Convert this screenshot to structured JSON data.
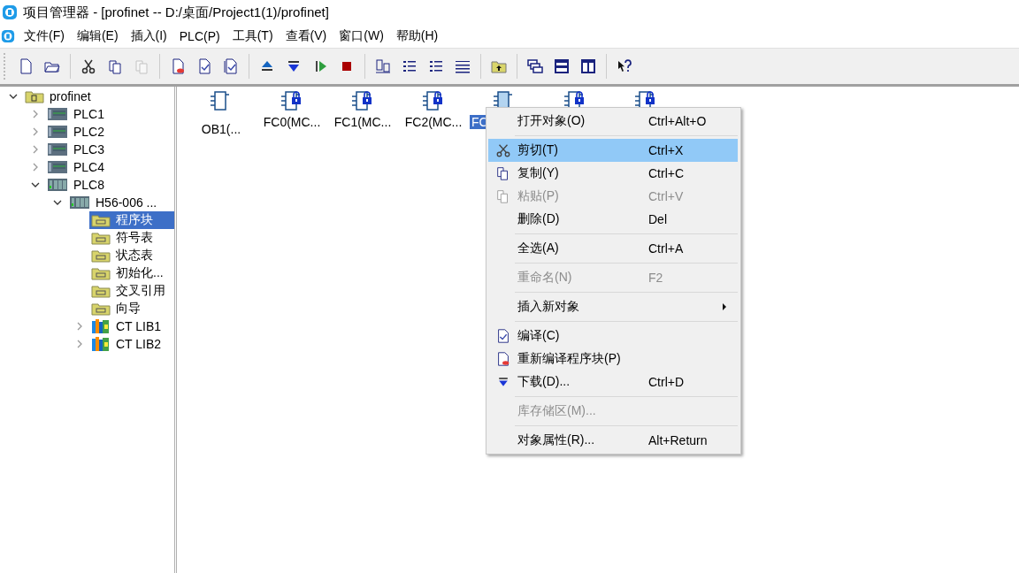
{
  "window": {
    "title": "项目管理器 - [profinet -- D:/桌面/Project1(1)/profinet]"
  },
  "menu_bar": [
    "文件(F)",
    "编辑(E)",
    "插入(I)",
    "PLC(P)",
    "工具(T)",
    "查看(V)",
    "窗口(W)",
    "帮助(H)"
  ],
  "toolbar": [
    {
      "kind": "new",
      "disabled": false
    },
    {
      "kind": "open",
      "disabled": false
    },
    {
      "kind": "sep"
    },
    {
      "kind": "cut",
      "disabled": false
    },
    {
      "kind": "copy",
      "disabled": false
    },
    {
      "kind": "paste",
      "disabled": true
    },
    {
      "kind": "sep"
    },
    {
      "kind": "rebuild",
      "disabled": false
    },
    {
      "kind": "compile",
      "disabled": false
    },
    {
      "kind": "compile-all",
      "disabled": false
    },
    {
      "kind": "sep"
    },
    {
      "kind": "upload",
      "disabled": false
    },
    {
      "kind": "download",
      "disabled": false
    },
    {
      "kind": "run",
      "disabled": false
    },
    {
      "kind": "stop",
      "disabled": false
    },
    {
      "kind": "sep"
    },
    {
      "kind": "devices",
      "disabled": false
    },
    {
      "kind": "list",
      "disabled": false
    },
    {
      "kind": "details",
      "disabled": false
    },
    {
      "kind": "grid",
      "disabled": false
    },
    {
      "kind": "sep"
    },
    {
      "kind": "up-folder",
      "disabled": false
    },
    {
      "kind": "sep"
    },
    {
      "kind": "cascade",
      "disabled": false
    },
    {
      "kind": "tile-h",
      "disabled": false
    },
    {
      "kind": "tile-v",
      "disabled": false
    },
    {
      "kind": "sep"
    },
    {
      "kind": "help",
      "disabled": false
    }
  ],
  "tree": [
    {
      "label": "profinet",
      "kind": "project",
      "expanded": true,
      "selected": false,
      "children": [
        {
          "label": "PLC1",
          "kind": "plc",
          "expanded": false,
          "selected": false
        },
        {
          "label": "PLC2",
          "kind": "plc",
          "expanded": false,
          "selected": false
        },
        {
          "label": "PLC3",
          "kind": "plc",
          "expanded": false,
          "selected": false
        },
        {
          "label": "PLC4",
          "kind": "plc",
          "expanded": false,
          "selected": false
        },
        {
          "label": "PLC8",
          "kind": "rack",
          "expanded": true,
          "selected": false,
          "children": [
            {
              "label": "H56-006 ...",
              "kind": "rack",
              "expanded": true,
              "selected": false,
              "children": [
                {
                  "label": "程序块",
                  "kind": "folder",
                  "selected": true
                },
                {
                  "label": "符号表",
                  "kind": "folder",
                  "selected": false
                },
                {
                  "label": "状态表",
                  "kind": "folder",
                  "selected": false
                },
                {
                  "label": "初始化...",
                  "kind": "folder",
                  "selected": false
                },
                {
                  "label": "交叉引用",
                  "kind": "folder",
                  "selected": false
                },
                {
                  "label": "向导",
                  "kind": "folder",
                  "selected": false
                },
                {
                  "label": "CT LIB1",
                  "kind": "library",
                  "expanded": false,
                  "selected": false
                },
                {
                  "label": "CT LIB2",
                  "kind": "library",
                  "expanded": false,
                  "selected": false
                }
              ]
            }
          ]
        }
      ]
    }
  ],
  "objects": [
    {
      "label": "OB1(...",
      "locked": false,
      "selected": false
    },
    {
      "label": "FC0(MC...",
      "locked": true,
      "selected": false
    },
    {
      "label": "FC1(MC...",
      "locked": true,
      "selected": false
    },
    {
      "label": "FC2(MC...",
      "locked": true,
      "selected": false
    },
    {
      "label": "FC",
      "locked": false,
      "selected": true
    },
    {
      "locked": true,
      "selected": false
    },
    {
      "locked": true,
      "selected": false
    }
  ],
  "context_menu": [
    {
      "kind": "item",
      "label": "打开对象(O)",
      "shortcut": "Ctrl+Alt+O",
      "disabled": false,
      "selected": false
    },
    {
      "kind": "separator"
    },
    {
      "kind": "cut",
      "label": "剪切(T)",
      "shortcut": "Ctrl+X",
      "disabled": false,
      "selected": true
    },
    {
      "kind": "copy",
      "label": "复制(Y)",
      "shortcut": "Ctrl+C",
      "disabled": false,
      "selected": false
    },
    {
      "kind": "paste",
      "label": "粘贴(P)",
      "shortcut": "Ctrl+V",
      "disabled": true,
      "selected": false
    },
    {
      "kind": "item",
      "label": "删除(D)",
      "shortcut": "Del",
      "disabled": false,
      "selected": false
    },
    {
      "kind": "separator"
    },
    {
      "kind": "item",
      "label": "全选(A)",
      "shortcut": "Ctrl+A",
      "disabled": false,
      "selected": false
    },
    {
      "kind": "separator"
    },
    {
      "kind": "item",
      "label": "重命名(N)",
      "shortcut": "F2",
      "disabled": true,
      "selected": false
    },
    {
      "kind": "separator"
    },
    {
      "kind": "submenu",
      "label": "插入新对象",
      "disabled": false,
      "selected": false
    },
    {
      "kind": "separator"
    },
    {
      "kind": "compile",
      "label": "编译(C)",
      "disabled": false,
      "selected": false
    },
    {
      "kind": "rebuild",
      "label": "重新编译程序块(P)",
      "disabled": false,
      "selected": false
    },
    {
      "kind": "download",
      "label": "下载(D)...",
      "shortcut": "Ctrl+D",
      "disabled": false,
      "selected": false
    },
    {
      "kind": "separator"
    },
    {
      "kind": "item",
      "label": "库存储区(M)...",
      "disabled": true,
      "selected": false
    },
    {
      "kind": "separator"
    },
    {
      "kind": "item",
      "label": "对象属性(R)...",
      "shortcut": "Alt+Return",
      "disabled": false,
      "selected": false
    }
  ]
}
